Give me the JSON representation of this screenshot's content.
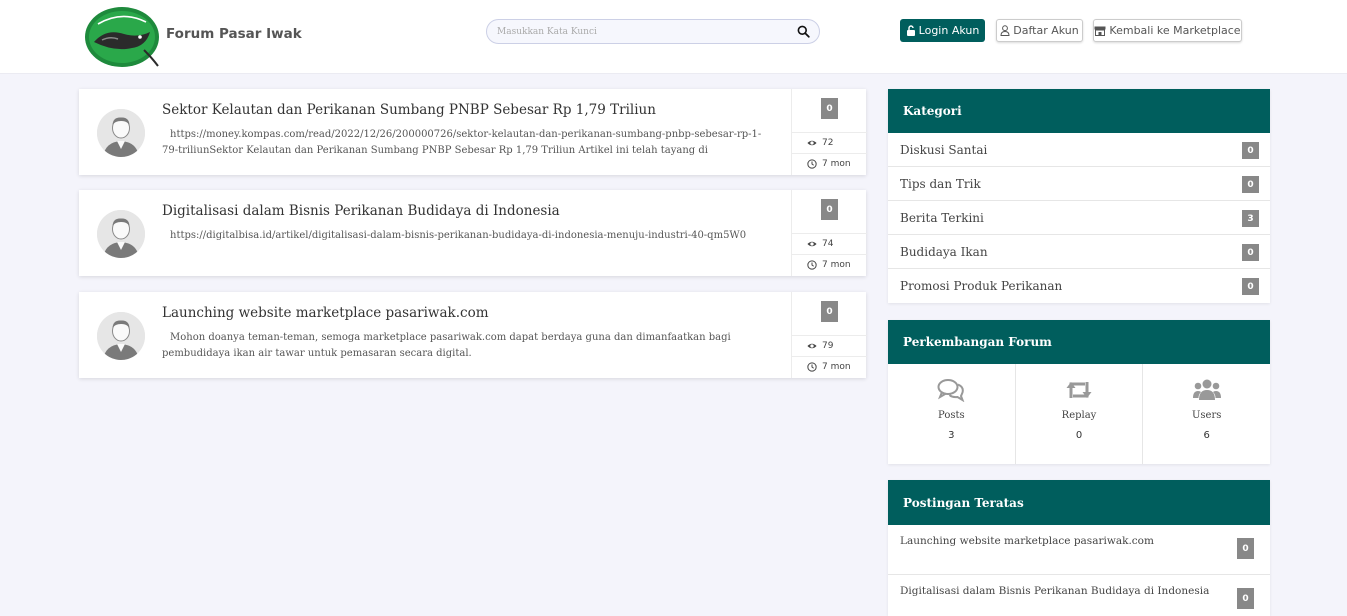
{
  "header": {
    "brand": "Forum Pasar Iwak",
    "search_placeholder": "Masukkan Kata Kunci",
    "login_label": "Login Akun",
    "daftar_label": "Daftar Akun",
    "back_label": "Kembali ke Marketplace"
  },
  "posts": [
    {
      "title": "Sektor Kelautan dan Perikanan Sumbang PNBP Sebesar Rp 1,79 Triliun",
      "excerpt": "https://money.kompas.com/read/2022/12/26/200000726/sektor-kelautan-dan-perikanan-sumbang-pnbp-sebesar-rp-1-79-triliunSektor Kelautan dan Perikanan Sumbang PNBP Sebesar Rp 1,79 Triliun Artikel ini telah tayang di",
      "replies": "0",
      "views": "72",
      "time": "7 mon"
    },
    {
      "title": "Digitalisasi dalam Bisnis Perikanan Budidaya di Indonesia",
      "excerpt": "https://digitalbisa.id/artikel/digitalisasi-dalam-bisnis-perikanan-budidaya-di-indonesia-menuju-industri-40-qm5W0",
      "replies": "0",
      "views": "74",
      "time": "7 mon"
    },
    {
      "title": "Launching website marketplace pasariwak.com",
      "excerpt": "Mohon doanya teman-teman, semoga marketplace pasariwak.com dapat berdaya guna dan dimanfaatkan bagi pembudidaya ikan air tawar untuk pemasaran secara digital.",
      "replies": "0",
      "views": "79",
      "time": "7 mon"
    }
  ],
  "kategori": {
    "title": "Kategori",
    "items": [
      {
        "label": "Diskusi Santai",
        "count": "0"
      },
      {
        "label": "Tips dan Trik",
        "count": "0"
      },
      {
        "label": "Berita Terkini",
        "count": "3"
      },
      {
        "label": "Budidaya Ikan",
        "count": "0"
      },
      {
        "label": "Promosi Produk Perikanan",
        "count": "0"
      }
    ]
  },
  "perkembangan": {
    "title": "Perkembangan Forum",
    "stats": [
      {
        "label": "Posts",
        "value": "3",
        "icon": "comments-icon"
      },
      {
        "label": "Replay",
        "value": "0",
        "icon": "retweet-icon"
      },
      {
        "label": "Users",
        "value": "6",
        "icon": "users-icon"
      }
    ]
  },
  "teratas": {
    "title": "Postingan Teratas",
    "items": [
      {
        "label": "Launching website marketplace pasariwak.com",
        "count": "0"
      },
      {
        "label": "Digitalisasi dalam Bisnis Perikanan Budidaya di Indonesia",
        "count": "0"
      }
    ]
  },
  "colors": {
    "primary": "#005e5d",
    "badge": "#888888",
    "background": "#f4f4fb"
  }
}
